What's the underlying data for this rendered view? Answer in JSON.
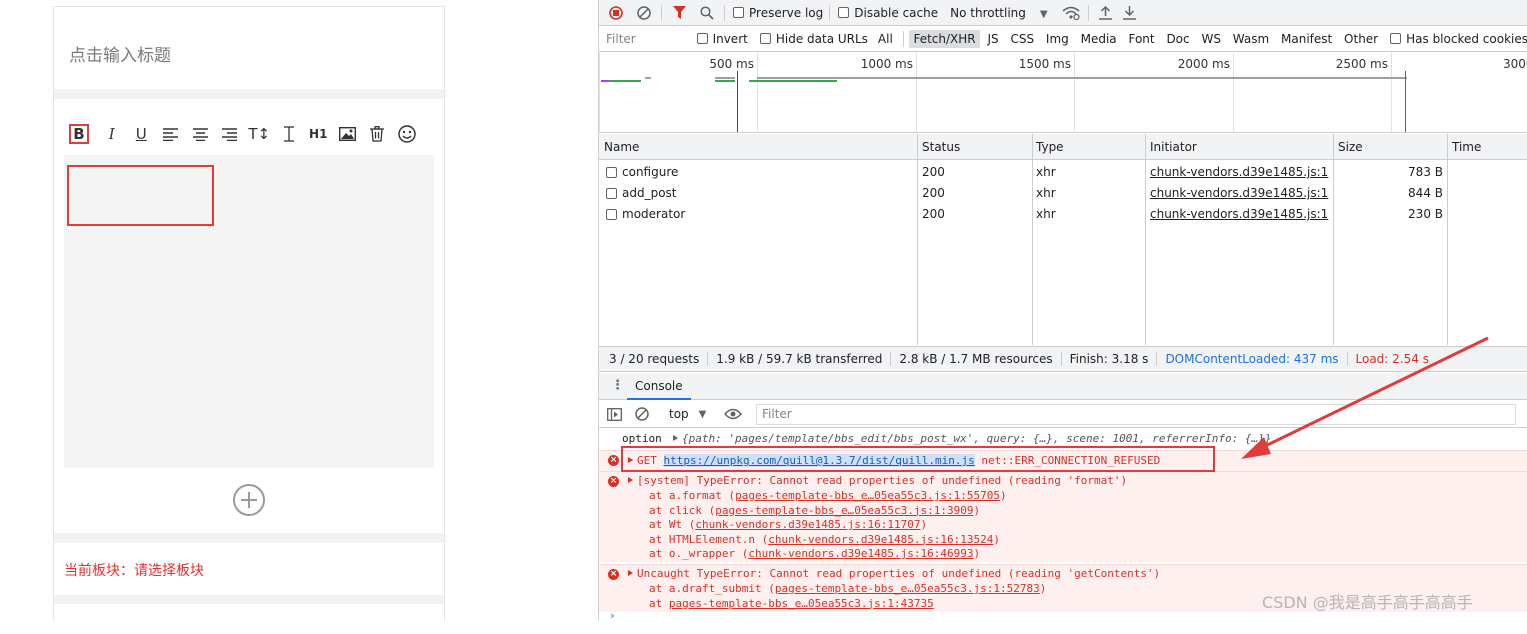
{
  "editor": {
    "title_placeholder": "点击输入标题",
    "toolbar": [
      {
        "name": "bold-button",
        "glyph": "B"
      },
      {
        "name": "italic-button",
        "glyph": "I"
      },
      {
        "name": "underline-button",
        "glyph": "U"
      },
      {
        "name": "align-left-button",
        "glyph": "align-left-icon"
      },
      {
        "name": "align-center-button",
        "glyph": "align-center-icon"
      },
      {
        "name": "align-right-button",
        "glyph": "align-right-icon"
      },
      {
        "name": "font-size-button",
        "glyph": "T↕"
      },
      {
        "name": "clear-format-button",
        "glyph": "clear-format-icon"
      },
      {
        "name": "heading-button",
        "glyph": "H1"
      },
      {
        "name": "image-button",
        "glyph": "image-icon"
      },
      {
        "name": "delete-button",
        "glyph": "trash-icon"
      },
      {
        "name": "emoji-button",
        "glyph": "emoji-icon"
      }
    ],
    "board_label": "当前板块：请选择板块"
  },
  "devtools": {
    "toolbar1": {
      "preserve_log": "Preserve log",
      "disable_cache": "Disable cache",
      "throttling": "No throttling"
    },
    "toolbar2": {
      "filter_placeholder": "Filter",
      "invert": "Invert",
      "hide_data_urls": "Hide data URLs",
      "types": [
        "All",
        "Fetch/XHR",
        "JS",
        "CSS",
        "Img",
        "Media",
        "Font",
        "Doc",
        "WS",
        "Wasm",
        "Manifest",
        "Other"
      ],
      "selected_type": "Fetch/XHR",
      "has_blocked": "Has blocked cookies"
    },
    "timeline_ticks": [
      "500 ms",
      "1000 ms",
      "1500 ms",
      "2000 ms",
      "2500 ms",
      "3000"
    ],
    "table": {
      "headers": [
        "Name",
        "Status",
        "Type",
        "Initiator",
        "Size",
        "Time"
      ],
      "rows": [
        {
          "name": "configure",
          "status": "200",
          "type": "xhr",
          "initiator": "chunk-vendors.d39e1485.js:1",
          "size": "783 B"
        },
        {
          "name": "add_post",
          "status": "200",
          "type": "xhr",
          "initiator": "chunk-vendors.d39e1485.js:1",
          "size": "844 B"
        },
        {
          "name": "moderator",
          "status": "200",
          "type": "xhr",
          "initiator": "chunk-vendors.d39e1485.js:1",
          "size": "230 B"
        }
      ]
    },
    "summary": {
      "requests": "3 / 20 requests",
      "transferred": "1.9 kB / 59.7 kB transferred",
      "resources": "2.8 kB / 1.7 MB resources",
      "finish": "Finish: 3.18 s",
      "dcl": "DOMContentLoaded: 437 ms",
      "load": "Load: 2.54 s"
    },
    "console": {
      "tab": "Console",
      "context": "top",
      "filter_placeholder": "Filter",
      "option_line_label": "option",
      "option_line_value": "{path: 'pages/template/bbs_edit/bbs_post_wx', query: {…}, scene: 1001, referrerInfo: {…}}",
      "error1": {
        "method": "GET",
        "url": "https://unpkg.com/quill@1.3.7/dist/quill.min.js",
        "status": "net::ERR_CONNECTION_REFUSED"
      },
      "error2": {
        "message": "[system] TypeError: Cannot read properties of undefined (reading 'format')",
        "stack": [
          {
            "fn": "at a.format (",
            "link": "pages-template-bbs_e…05ea55c3.js:1:55705",
            "end": ")"
          },
          {
            "fn": "at click (",
            "link": "pages-template-bbs_e…05ea55c3.js:1:3909",
            "end": ")"
          },
          {
            "fn": "at Wt (",
            "link": "chunk-vendors.d39e1485.js:16:11707",
            "end": ")"
          },
          {
            "fn": "at HTMLElement.n (",
            "link": "chunk-vendors.d39e1485.js:16:13524",
            "end": ")"
          },
          {
            "fn": "at o._wrapper (",
            "link": "chunk-vendors.d39e1485.js:16:46993",
            "end": ")"
          }
        ]
      },
      "error3": {
        "message": "Uncaught TypeError: Cannot read properties of undefined (reading 'getContents')",
        "stack": [
          {
            "fn": "at a.draft_submit (",
            "link": "pages-template-bbs_e…05ea55c3.js:1:52783",
            "end": ")"
          },
          {
            "fn": "at ",
            "link": "pages-template-bbs_e…05ea55c3.js:1:43735",
            "end": ""
          }
        ]
      }
    }
  },
  "watermark": "CSDN @我是高手高手高高手",
  "colors": {
    "annotation_red": "#e23b3b",
    "error_red": "#d93025",
    "link_blue": "#1a73e8"
  }
}
